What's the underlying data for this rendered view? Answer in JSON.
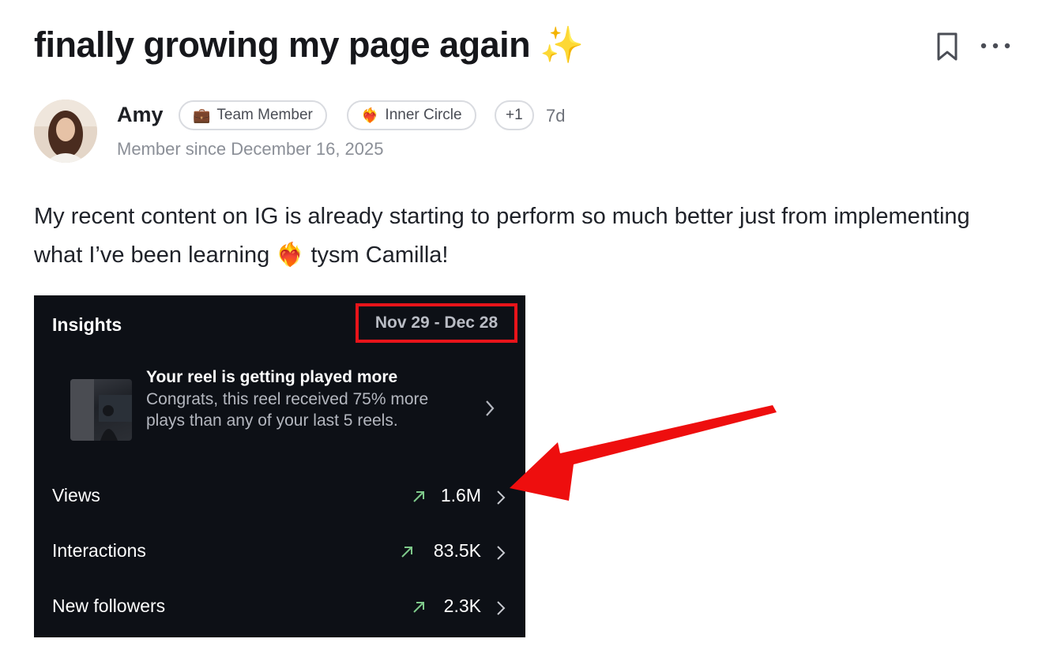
{
  "post": {
    "title": "finally growing my page again",
    "title_emoji": "✨",
    "body": "My recent content on IG is already starting to perform so much better just from implementing what I’ve been learning ❤️‍🔥 tysm Camilla!"
  },
  "author": {
    "name": "Amy",
    "member_since": "Member since December 16, 2025",
    "age": "7d",
    "badges": [
      {
        "icon": "💼",
        "label": "Team Member"
      },
      {
        "icon": "❤️‍🔥",
        "label": "Inner Circle"
      },
      {
        "icon": "",
        "label": "+1"
      }
    ]
  },
  "insights": {
    "title": "Insights",
    "date_range": "Nov 29 - Dec 28",
    "reel_title": "Your reel is getting played more",
    "reel_desc": "Congrats, this reel received 75% more plays than any of your last 5 reels.",
    "metrics": [
      {
        "label": "Views",
        "value": "1.6M"
      },
      {
        "label": "Interactions",
        "value": "83.5K"
      },
      {
        "label": "New followers",
        "value": "2.3K"
      }
    ]
  },
  "icons": {
    "bookmark": "bookmark-icon",
    "more": "more-options-icon",
    "trend": "trend-up-icon",
    "chevron": "chevron-right-icon",
    "annotation": "red-arrow-annotation"
  },
  "colors": {
    "trend_green": "#7ec98a",
    "highlight_red": "#e8141a",
    "card_bg": "#0d1016"
  }
}
